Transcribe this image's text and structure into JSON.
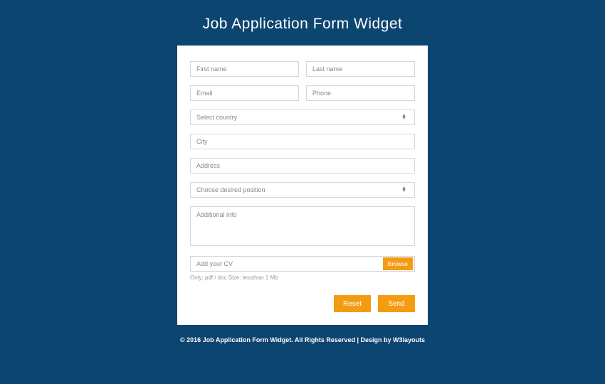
{
  "title": "Job Application Form Widget",
  "fields": {
    "first_name": "First name",
    "last_name": "Last name",
    "email": "Email",
    "phone": "Phone",
    "country": "Select country",
    "city": "City",
    "address": "Address",
    "position": "Choose desired position",
    "additional": "Additional info",
    "cv": "Add your CV"
  },
  "browse": "Browse",
  "hint": "Only: pdf / doc Size: lessthan 1 Mb",
  "buttons": {
    "reset": "Reset",
    "send": "Send"
  },
  "footer": "© 2016 Job Application Form Widget. All Rights Reserved | Design by W3layouts"
}
